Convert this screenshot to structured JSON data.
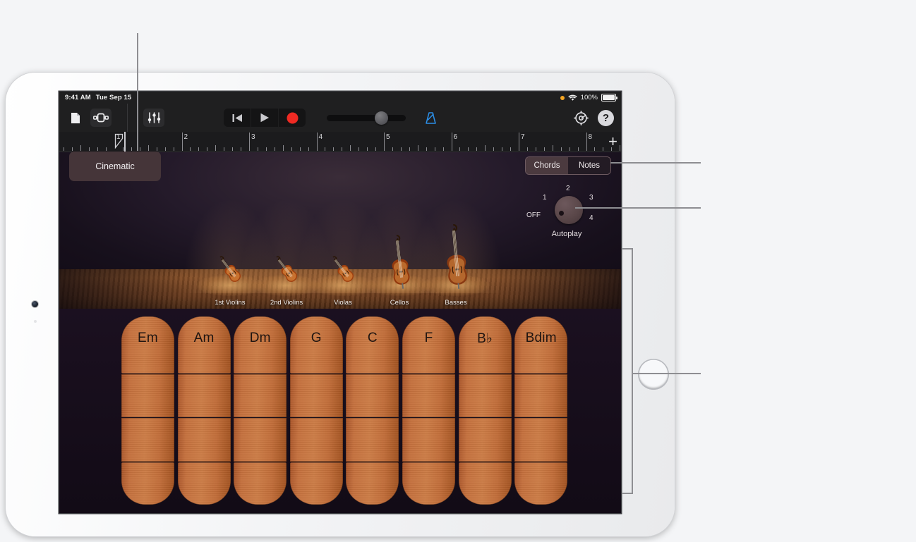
{
  "status_bar": {
    "time": "9:41 AM",
    "date": "Tue Sep 15",
    "battery": "100%",
    "wifi_icon": "wifi-icon",
    "recording_dot": "orange-status-dot"
  },
  "toolbar": {
    "navigation_icon": "document-icon",
    "view_icon": "track-view-icon",
    "mixer_icon": "mixer-sliders-icon",
    "rewind_icon": "rewind-to-start-icon",
    "play_icon": "play-icon",
    "record_icon": "record-icon",
    "master_volume_label": "master-volume-slider",
    "metronome_icon": "metronome-icon",
    "settings_icon": "gear-icon",
    "help_label": "?"
  },
  "ruler": {
    "bars": [
      "1",
      "2",
      "3",
      "4",
      "5",
      "6",
      "7",
      "8"
    ],
    "add_section_label": "+",
    "playhead_position": "1"
  },
  "track": {
    "instrument_name": "Cinematic"
  },
  "stage": {
    "instruments": [
      {
        "label": "1st Violins",
        "type": "violin"
      },
      {
        "label": "2nd Violins",
        "type": "violin"
      },
      {
        "label": "Violas",
        "type": "violin"
      },
      {
        "label": "Cellos",
        "type": "cello"
      },
      {
        "label": "Basses",
        "type": "bass"
      }
    ]
  },
  "mode_switch": {
    "options": [
      "Chords",
      "Notes"
    ],
    "selected": "Chords"
  },
  "autoplay": {
    "title": "Autoplay",
    "positions": [
      "OFF",
      "1",
      "2",
      "3",
      "4"
    ],
    "selected": "OFF"
  },
  "chords": {
    "strips": [
      {
        "name": "Em"
      },
      {
        "name": "Am"
      },
      {
        "name": "Dm"
      },
      {
        "name": "G"
      },
      {
        "name": "C"
      },
      {
        "name": "F"
      },
      {
        "name": "B♭"
      },
      {
        "name": "Bdim"
      }
    ],
    "segments_per_strip": 4
  },
  "colors": {
    "screen_bg": "#120b16",
    "toolbar_bg": "#1f1f20",
    "chord_wood": "#c4703d",
    "accent_blue": "#2b8fe8",
    "record_red": "#ef2a23",
    "chip_bg": "#453539",
    "callout_gray": "#8e8e92"
  }
}
